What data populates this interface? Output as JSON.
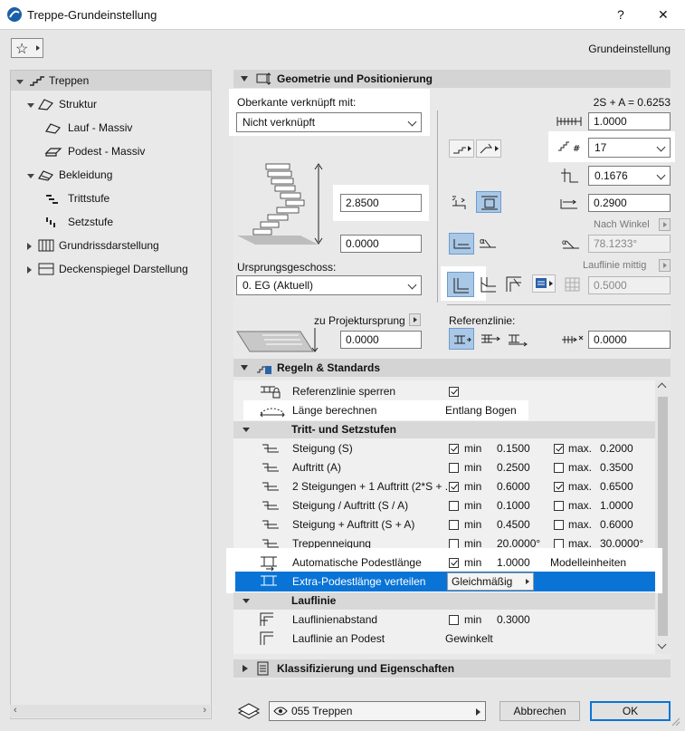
{
  "window": {
    "title": "Treppe-Grundeinstellung",
    "help_glyph": "?",
    "close_glyph": "✕"
  },
  "header": {
    "subtitle": "Grundeinstellung"
  },
  "tree": [
    {
      "label": "Treppen"
    },
    {
      "label": "Struktur"
    },
    {
      "label": "Lauf - Massiv"
    },
    {
      "label": "Podest - Massiv"
    },
    {
      "label": "Bekleidung"
    },
    {
      "label": "Trittstufe"
    },
    {
      "label": "Setzstufe"
    },
    {
      "label": "Grundrissdarstellung"
    },
    {
      "label": "Deckenspiegel Darstellung"
    }
  ],
  "geometry": {
    "section_title": "Geometrie und Positionierung",
    "top_link_label": "Oberkante verknüpft mit:",
    "top_link_value": "Nicht verknüpft",
    "height": "2.8500",
    "offset": "0.0000",
    "origin_label": "Ursprungsgeschoss:",
    "origin_value": "0. EG (Aktuell)",
    "project_origin_label": "zu Projekturspr​ung",
    "project_origin_value": "0.0000",
    "formula": "2S + A = 0.6253",
    "width": "1.0000",
    "risers": "17",
    "riser_height": "0.1676",
    "tread_depth": "0.2900",
    "by_angle_label": "Nach Winkel",
    "angle": "78.1233°",
    "walkline_label": "Lauflinie mittig",
    "walkline_value": "0.5000",
    "reference_label": "Referenzlinie:",
    "reference_value": "0.0000"
  },
  "rules": {
    "section_title": "Regeln & Standards",
    "lock_ref_label": "Referenzlinie sperren",
    "calc_length_label": "Länge berechnen",
    "calc_length_value": "Entlang Bogen",
    "group_treads": "Tritt- und Setzstufen",
    "rows": [
      {
        "label": "Steigung (S)",
        "min_on": true,
        "min": "0.1500",
        "max_on": true,
        "max": "0.2000"
      },
      {
        "label": "Auftritt (A)",
        "min_on": false,
        "min": "0.2500",
        "max_on": false,
        "max": "0.3500"
      },
      {
        "label": "2 Steigungen + 1 Auftritt (2*S + ...",
        "min_on": true,
        "min": "0.6000",
        "max_on": true,
        "max": "0.6500"
      },
      {
        "label": "Steigung / Auftritt (S / A)",
        "min_on": false,
        "min": "0.1000",
        "max_on": false,
        "max": "1.0000"
      },
      {
        "label": "Steigung + Auftritt (S + A)",
        "min_on": false,
        "min": "0.4500",
        "max_on": false,
        "max": "0.6000"
      },
      {
        "label": "Treppenneigung",
        "min_on": false,
        "min": "20.0000°",
        "max_on": false,
        "max": "30.0000°"
      }
    ],
    "min_label": "min",
    "max_label": "max.",
    "auto_landing_label": "Automatische Podestlänge",
    "auto_landing_min": "1.0000",
    "auto_landing_unit": "Modelleinheiten",
    "extra_landing_label": "Extra-Podestlänge verteilen",
    "extra_landing_value": "Gleichmäßig",
    "group_walkline": "Lauflinie",
    "walkline_distance_label": "Lauflinienabstand",
    "walkline_distance_value": "0.3000",
    "walkline_landing_label": "Lauflinie an Podest",
    "walkline_landing_value": "Gewinkelt"
  },
  "classification": {
    "section_title": "Klassifizierung und Eigenschaften"
  },
  "footer": {
    "layer_value": "055 Treppen",
    "cancel_label": "Abbrechen",
    "ok_label": "OK"
  }
}
